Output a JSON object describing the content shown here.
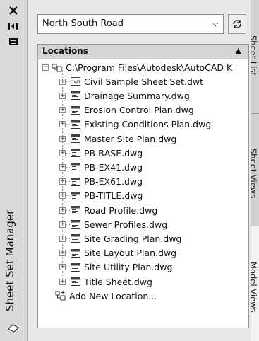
{
  "palette": {
    "title": "Sheet Set Manager",
    "icons": [
      "close-icon",
      "auto-hide-icon",
      "properties-icon",
      "sheet-set-icon"
    ]
  },
  "toolbar": {
    "dropdown_value": "North South Road",
    "refresh_icon": "refresh-icon",
    "publish_icon": "sheet-set-properties-icon"
  },
  "panel": {
    "title": "Locations",
    "root": {
      "label": "C:\\Program Files\\Autodesk\\AutoCAD K",
      "icon": "folder-location-icon"
    },
    "items": [
      {
        "label": "Civil Sample Sheet Set.dwt",
        "icon": "dwt-icon"
      },
      {
        "label": "Drainage Summary.dwg",
        "icon": "dwg-icon"
      },
      {
        "label": "Erosion Control Plan.dwg",
        "icon": "dwg-icon"
      },
      {
        "label": "Existing Conditions Plan.dwg",
        "icon": "dwg-icon"
      },
      {
        "label": "Master Site Plan.dwg",
        "icon": "dwg-icon"
      },
      {
        "label": "PB-BASE.dwg",
        "icon": "dwg-icon"
      },
      {
        "label": "PB-EX41.dwg",
        "icon": "dwg-icon"
      },
      {
        "label": "PB-EX61.dwg",
        "icon": "dwg-icon"
      },
      {
        "label": "PB-TITLE.dwg",
        "icon": "dwg-icon"
      },
      {
        "label": "Road Profile.dwg",
        "icon": "dwg-icon"
      },
      {
        "label": "Sewer Profiles.dwg",
        "icon": "dwg-icon"
      },
      {
        "label": "Site Grading Plan.dwg",
        "icon": "dwg-icon"
      },
      {
        "label": "Site Layout Plan.dwg",
        "icon": "dwg-icon"
      },
      {
        "label": "Site Utility Plan.dwg",
        "icon": "dwg-icon"
      },
      {
        "label": "Title Sheet.dwg",
        "icon": "dwg-icon"
      }
    ],
    "add_location": "Add New Location..."
  },
  "tabs": [
    "Sheet List",
    "Sheet Views",
    "Model Views"
  ]
}
